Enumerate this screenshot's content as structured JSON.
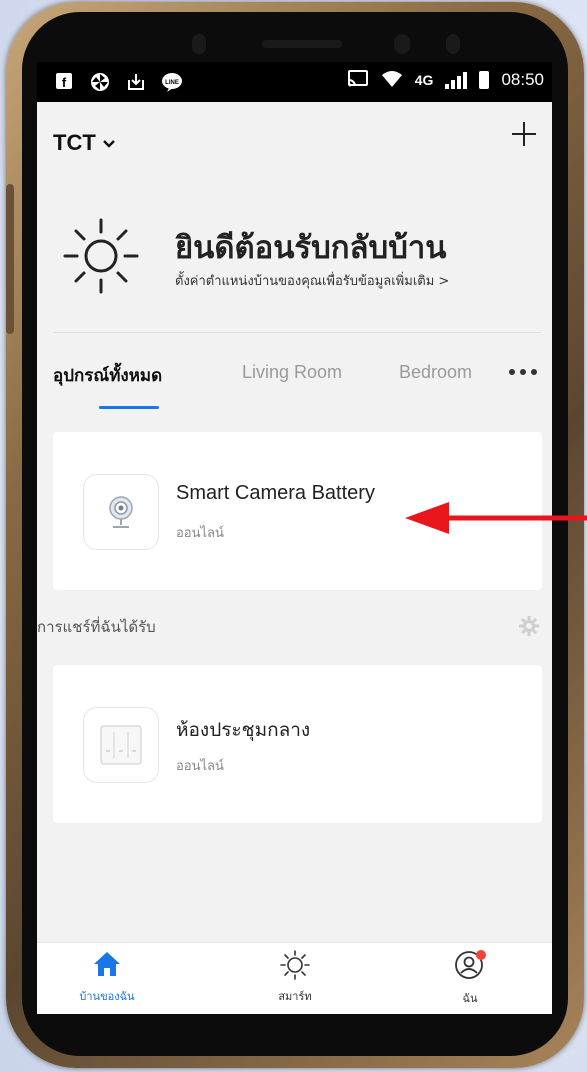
{
  "statusbar": {
    "left_icons": [
      "facebook-icon",
      "pinwheel-icon",
      "download-icon",
      "line-chat-icon"
    ],
    "network": "4G",
    "time": "08:50"
  },
  "header": {
    "home_name": "TCT"
  },
  "welcome": {
    "title": "ยินดีต้อนรับกลับบ้าน",
    "subtitle": "ตั้งค่าตำแหน่งบ้านของคุณเพื่อรับข้อมูลเพิ่มเติม >"
  },
  "tabs": [
    {
      "label": "อุปกรณ์ทั้งหมด",
      "active": true
    },
    {
      "label": "Living Room",
      "active": false
    },
    {
      "label": "Bedroom",
      "active": false
    }
  ],
  "devices": [
    {
      "name": "Smart Camera Battery",
      "status": "ออนไลน์"
    }
  ],
  "shared": {
    "label": "การแชร์ที่ฉันได้รับ",
    "devices": [
      {
        "name": "ห้องประชุมกลาง",
        "status": "ออนไลน์"
      }
    ]
  },
  "bottom_nav": [
    {
      "label": "บ้านของฉัน",
      "icon": "home-icon",
      "active": true
    },
    {
      "label": "สมาร์ท",
      "icon": "sun-icon",
      "active": false
    },
    {
      "label": "ฉัน",
      "icon": "profile-icon",
      "active": false
    }
  ],
  "colors": {
    "accent": "#1976e6",
    "arrow": "#e8161b",
    "badge": "#f04438"
  }
}
